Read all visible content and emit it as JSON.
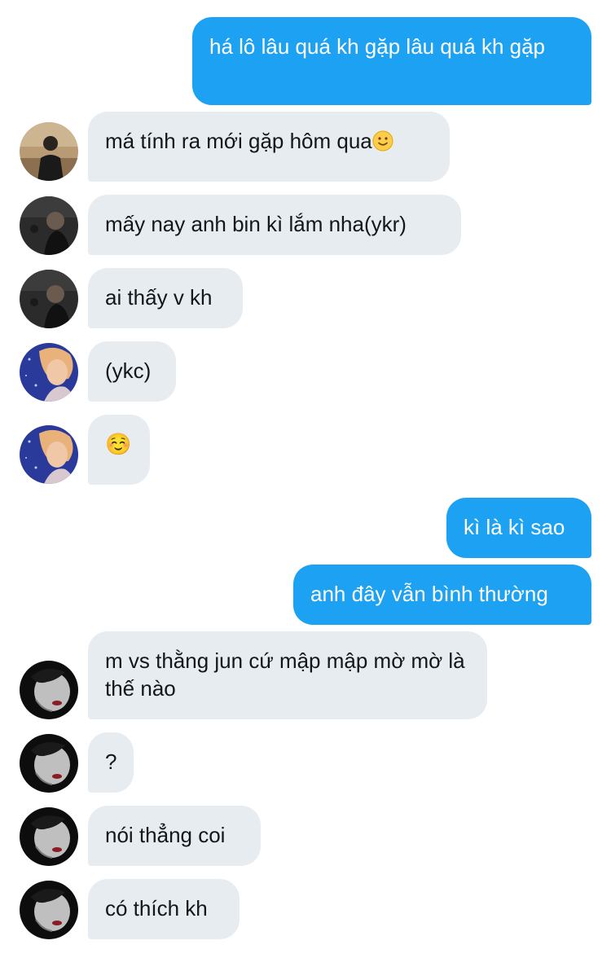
{
  "conversation": {
    "messages": [
      {
        "id": "m1",
        "direction": "outgoing",
        "text": "há lô lâu quá kh gặp lâu quá kh gặp"
      },
      {
        "id": "m2",
        "direction": "incoming",
        "sender_avatar": "avatar-1",
        "text": "má tính ra mới gặp hôm qua",
        "emoji": "slightly-smiling-face"
      },
      {
        "id": "m3",
        "direction": "incoming",
        "sender_avatar": "avatar-2",
        "text": "mấy nay anh bin kì lắm nha(ykr)"
      },
      {
        "id": "m4",
        "direction": "incoming",
        "sender_avatar": "avatar-2",
        "text": "ai thấy v kh"
      },
      {
        "id": "m5",
        "direction": "incoming",
        "sender_avatar": "avatar-3",
        "text": "(ykc)"
      },
      {
        "id": "m6",
        "direction": "incoming",
        "sender_avatar": "avatar-3",
        "text": "☺️"
      },
      {
        "id": "m7",
        "direction": "outgoing",
        "text": "kì là kì sao"
      },
      {
        "id": "m8",
        "direction": "outgoing",
        "text": "anh đây vẫn bình thường"
      },
      {
        "id": "m9",
        "direction": "incoming",
        "sender_avatar": "avatar-4",
        "text": "m vs thằng jun cứ mập mập mờ mờ là thế nào"
      },
      {
        "id": "m10",
        "direction": "incoming",
        "sender_avatar": "avatar-4",
        "text": "?"
      },
      {
        "id": "m11",
        "direction": "incoming",
        "sender_avatar": "avatar-4",
        "text": "nói thẳng coi"
      },
      {
        "id": "m12",
        "direction": "incoming",
        "sender_avatar": "avatar-4",
        "text": "có thích kh"
      }
    ]
  },
  "colors": {
    "outgoing_bubble": "#1da1f2",
    "incoming_bubble": "#e6ecf0",
    "incoming_text": "#14171a",
    "outgoing_text": "#ffffff"
  },
  "icons": {
    "avatar-1": "person-photo-avatar",
    "avatar-2": "dark-portrait-avatar",
    "avatar-3": "blonde-portrait-avatar",
    "avatar-4": "monochrome-portrait-avatar",
    "emoji": "slightly-smiling-face-icon"
  }
}
